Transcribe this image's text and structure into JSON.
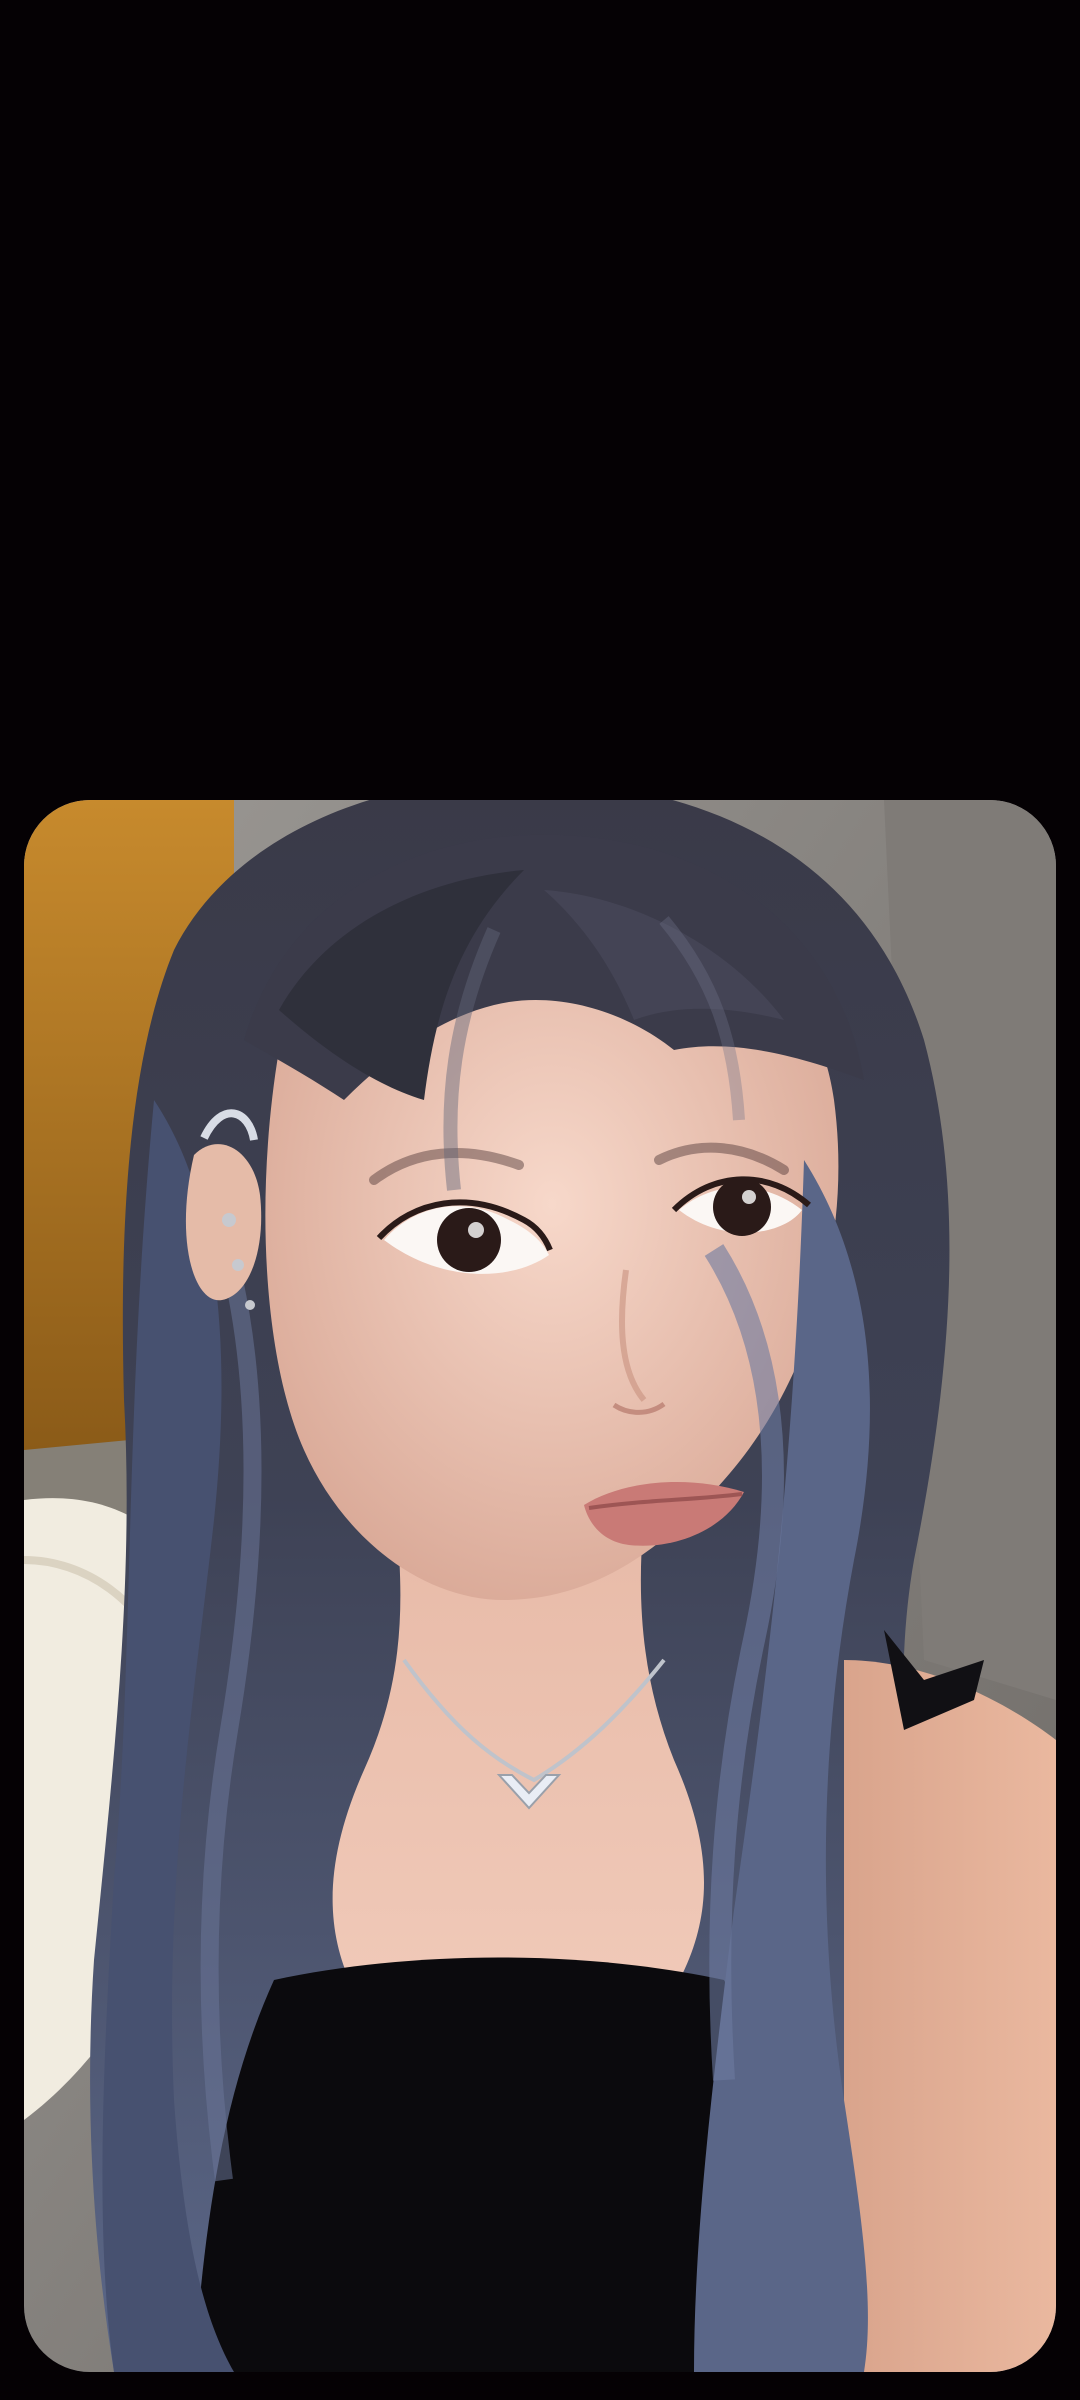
{
  "screen": {
    "background_color": "#050104"
  },
  "photo": {
    "subject": "selfie-portrait",
    "colors": {
      "wall_left": "#b47a22",
      "sofa": "#8b8784",
      "hair_top": "#3a3a48",
      "hair_bottom": "#55607f",
      "skin": "#edc6b5",
      "top": "#0b0a0d",
      "jacket": "#f1ece0"
    }
  }
}
